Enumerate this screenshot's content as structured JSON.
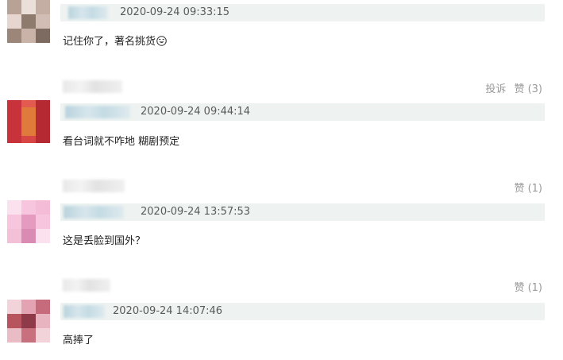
{
  "comments": [
    {
      "timestamp": "2020-09-24 09:33:15",
      "text": "记住你了，著名挑货",
      "emoji": "smiley-face",
      "colors": {
        "avatar": [
          "#8f7a6e",
          "#d9c8c0",
          "#b79e93",
          "#eadfd9"
        ]
      }
    },
    {
      "timestamp": "2020-09-24 09:44:14",
      "text": "看台词就不咋地 糊剧预定",
      "report_label": "投诉",
      "like_label": "赞 (3)",
      "colors": {
        "avatar": [
          "#c8323a",
          "#e07a3a",
          "#b52a32",
          "#f0d0d0"
        ]
      }
    },
    {
      "timestamp": "2020-09-24 13:57:53",
      "text": "这是丢脸到国外？",
      "like_label": "赞 (1)",
      "colors": {
        "avatar": [
          "#f7c6de",
          "#e59ac0",
          "#fbe1ee",
          "#d98bb3"
        ]
      }
    },
    {
      "timestamp": "2020-09-24 14:07:46",
      "text": "高捧了",
      "like_label": "赞 (1)",
      "colors": {
        "avatar": [
          "#b8545e",
          "#e3a3b2",
          "#8e3a48",
          "#f2d3da"
        ]
      }
    }
  ]
}
